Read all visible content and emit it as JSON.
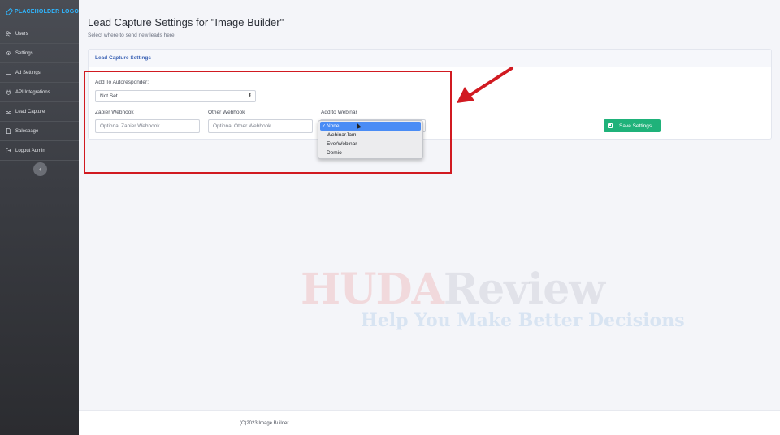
{
  "sidebar": {
    "logo_text": "PLACEHOLDER LOGO",
    "items": [
      {
        "label": "Users",
        "icon": "users-icon"
      },
      {
        "label": "Settings",
        "icon": "gear-icon"
      },
      {
        "label": "Ad Settings",
        "icon": "ad-icon"
      },
      {
        "label": "API Integrations",
        "icon": "plug-icon"
      },
      {
        "label": "Lead Capture",
        "icon": "inbox-icon"
      },
      {
        "label": "Salespage",
        "icon": "file-icon"
      },
      {
        "label": "Logout Admin",
        "icon": "logout-icon"
      }
    ],
    "collapse_glyph": "‹"
  },
  "header": {
    "title": "Lead Capture Settings for \"Image Builder\"",
    "subtitle": "Select where to send new leads here."
  },
  "card": {
    "title": "Lead Capture Settings",
    "autoresponder": {
      "label": "Add To Autoresponder:",
      "value": "Not Set",
      "arrow": "⬍"
    },
    "zapier": {
      "label": "Zapier Webhook",
      "placeholder": "Optional Zapier Webhook"
    },
    "other": {
      "label": "Other Webhook",
      "placeholder": "Optional Other Webhook"
    },
    "webinar": {
      "label": "Add to Webinar",
      "check": "✓",
      "options": [
        "None",
        "WebinarJam",
        "EverWebinar",
        "Demio"
      ],
      "selected": "None"
    },
    "save_label": "Save Settings"
  },
  "watermark": {
    "main_a": "HUDA",
    "main_b": "Review",
    "tagline": "Help You Make Better Decisions"
  },
  "footer": {
    "text": "(C)2023 Image Builder"
  },
  "colors": {
    "accent": "#3c63b5",
    "save": "#1fb27a",
    "annotation": "#d11a21",
    "selected_option": "#4a8cf5"
  }
}
